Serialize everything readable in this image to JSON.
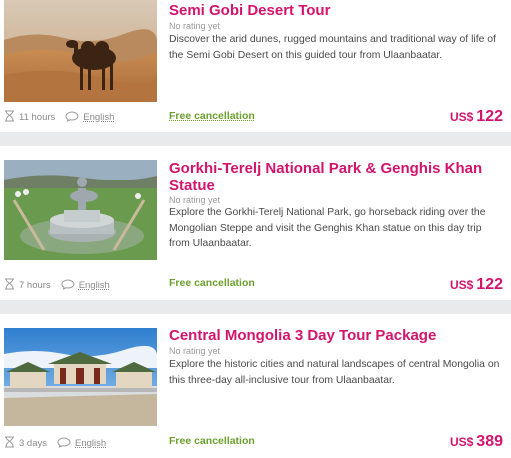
{
  "tours": [
    {
      "title": "Semi Gobi Desert Tour",
      "rating": "No rating yet",
      "description": "Discover the arid dunes, rugged mountains and traditional way of life of the Semi Gobi Desert on this guided tour from Ulaanbaatar.",
      "duration": "11 hours",
      "language": "English",
      "cancellation": "Free cancellation",
      "currency": "US$",
      "price": "122",
      "image_icon": "camel-desert-photo"
    },
    {
      "title": "Gorkhi-Terelj National Park & Genghis Khan Statue",
      "rating": "No rating yet",
      "description": "Explore the Gorkhi-Terelj National Park, go horseback riding over the Mongolian Steppe and visit the Genghis Khan statue on this day trip from Ulaanbaatar.",
      "duration": "7 hours",
      "language": "English",
      "cancellation": "Free cancellation",
      "currency": "US$",
      "price": "122",
      "image_icon": "genghis-statue-photo"
    },
    {
      "title": "Central Mongolia 3 Day Tour Package",
      "rating": "No rating yet",
      "description": "Explore the historic cities and natural landscapes of central Mongolia on this three-day all-inclusive tour from Ulaanbaatar.",
      "duration": "3 days",
      "language": "English",
      "cancellation": "Free cancellation",
      "currency": "US$",
      "price": "389",
      "image_icon": "monastery-photo"
    }
  ],
  "colors": {
    "accent": "#d3146d",
    "green": "#6ba02e"
  }
}
